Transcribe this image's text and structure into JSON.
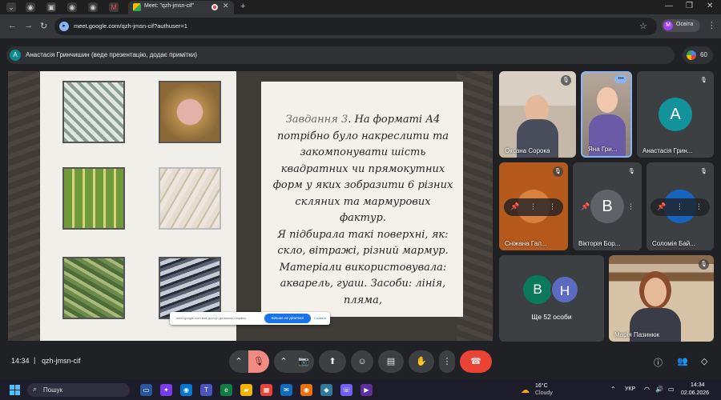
{
  "browser": {
    "tab_title": "Meet: \"qzh-jmsn-cif\"",
    "url": "meet.google.com/qzh-jmsn-cif?authuser=1",
    "profile_name": "Освіта",
    "profile_initial": "M"
  },
  "meet": {
    "presenter_initial": "А",
    "presenter_text": "Анастасія Гринчишин (веде презентацію, додає примітки)",
    "participant_count": "60",
    "share_banner": {
      "text": "meet.google.com має доступ до вашого екрана",
      "stop_label": "Більше не ділитися",
      "hide_label": "Сховати"
    },
    "slide": {
      "heading": "Завдання 3",
      "paragraph1": ". На форматі А4 потрібно було накреслити та закомпонувати шість квадратних чи прямокутних форм у яких зобразити 6 різних скляних та мармурових фактур.",
      "paragraph2": "Я підбирала такі поверхні, як: скло, вітражі, різний мармур. Матеріали використовувала: акварель, гуаш. Засоби: лінія, пляма,"
    },
    "participants": [
      {
        "name": "Оксана Сорока",
        "type": "video"
      },
      {
        "name": "Яна Гри...",
        "type": "video"
      },
      {
        "name": "Анастасія Грин...",
        "initial": "А",
        "color": "#12939a"
      },
      {
        "name": "Сніжана Гал...",
        "type": "controls"
      },
      {
        "name": "Вікторія Бор...",
        "initial": "В",
        "color": "#5f6368"
      },
      {
        "name": "Соломія Бай...",
        "type": "controls"
      },
      {
        "name": "Ще 52 особи",
        "initials": [
          "В",
          "Н"
        ],
        "colors": [
          "#0b7a5c",
          "#5c6bc0"
        ]
      },
      {
        "name": "Марія Пазинюк",
        "type": "video"
      }
    ],
    "bottom_bar": {
      "time": "14:34",
      "separator": "|",
      "meeting_code": "qzh-jmsn-cif"
    }
  },
  "taskbar": {
    "search_placeholder": "Пошук",
    "weather_temp": "16°C",
    "weather_condition": "Cloudy",
    "language": "УКР",
    "time": "14:34",
    "date": "02.06.2026"
  },
  "colors": {
    "meet_bg": "#202124",
    "end_call": "#ea4335",
    "mic_off": "#f28b82",
    "accent_blue": "#1a73e8"
  }
}
